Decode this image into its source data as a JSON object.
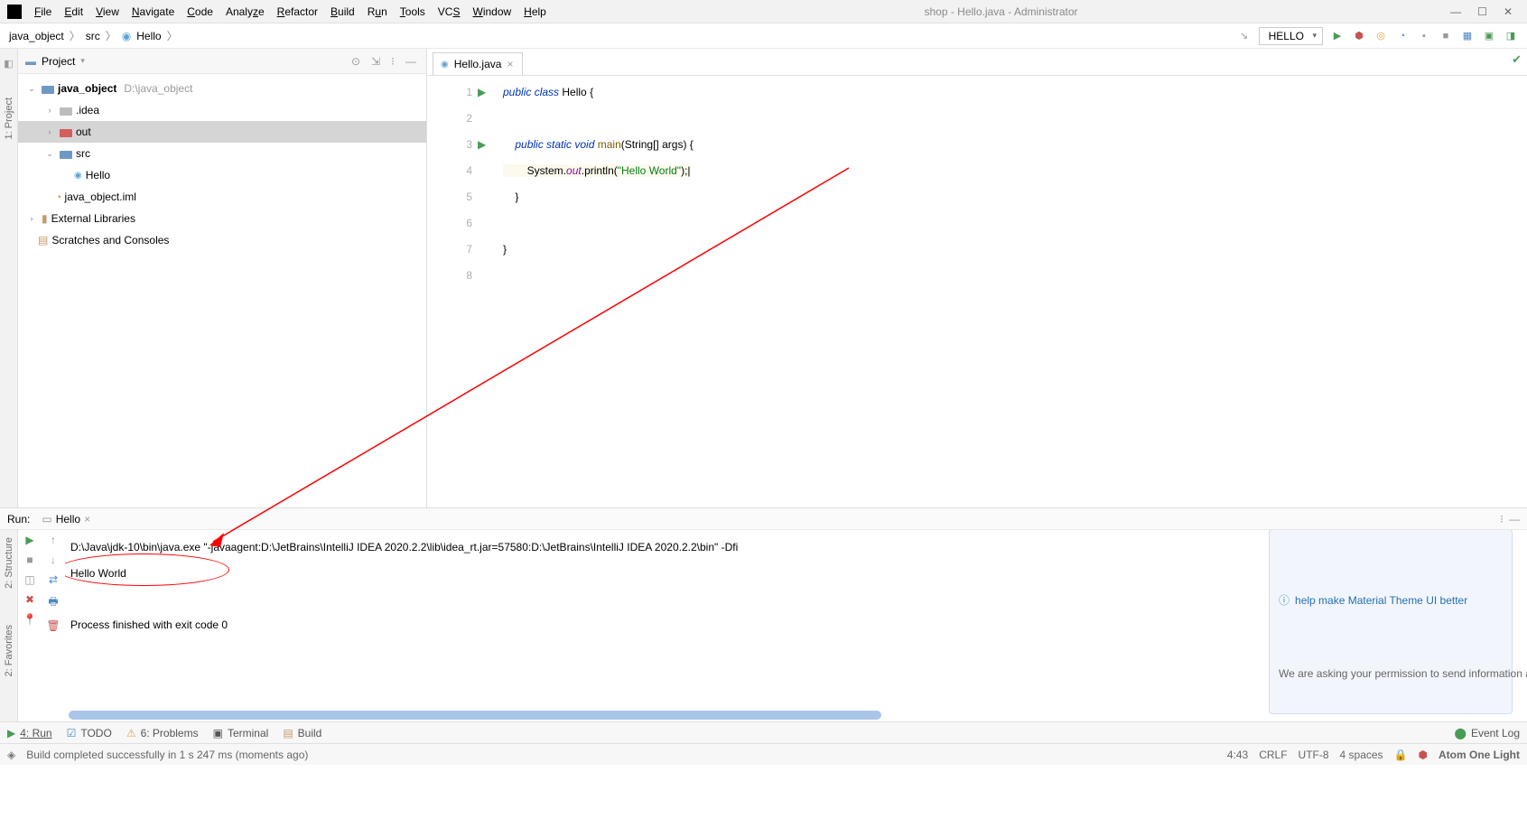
{
  "title": "shop - Hello.java - Administrator",
  "menu": [
    "File",
    "Edit",
    "View",
    "Navigate",
    "Code",
    "Analyze",
    "Refactor",
    "Build",
    "Run",
    "Tools",
    "VCS",
    "Window",
    "Help"
  ],
  "breadcrumb": [
    "java_object",
    "src",
    "Hello"
  ],
  "run_config": "HELLO",
  "project": {
    "panel_title": "Project",
    "root": "java_object",
    "root_path": "D:\\java_object",
    "children": [
      {
        "name": ".idea",
        "type": "folder-gray"
      },
      {
        "name": "out",
        "type": "folder-red",
        "selected": true
      },
      {
        "name": "src",
        "type": "folder-blue",
        "expanded": true,
        "children": [
          {
            "name": "Hello",
            "type": "class"
          }
        ]
      },
      {
        "name": "java_object.iml",
        "type": "file"
      }
    ],
    "external": "External Libraries",
    "scratches": "Scratches and Consoles"
  },
  "tab": "Hello.java",
  "lines": [
    "1",
    "2",
    "3",
    "4",
    "5",
    "6",
    "7",
    "8"
  ],
  "code": {
    "l1_kw": "public class",
    "l1_cls": "Hello",
    "l1_end": " {",
    "l3_kw": "public static void",
    "l3_mth": "main",
    "l3_sig": "(String[] args) {",
    "l4_sys": "System",
    "l4_out": "out",
    "l4_pr": "println",
    "l4_str": "\"Hello World\"",
    "l4_end": ");",
    "l5": "}",
    "l7": "}"
  },
  "run": {
    "label": "Run:",
    "tab": "Hello",
    "cmd": "D:\\Java\\jdk-10\\bin\\java.exe \"-javaagent:D:\\JetBrains\\IntelliJ IDEA 2020.2.2\\lib\\idea_rt.jar=57580:D:\\JetBrains\\IntelliJ IDEA 2020.2.2\\bin\" -Dfi",
    "out": "Hello World",
    "exit": "Process finished with exit code 0"
  },
  "notification": {
    "title": "help make Material Theme UI better",
    "body": "We are asking your permission to send information about your configuration (what..."
  },
  "bottom_tabs": [
    "4: Run",
    "TODO",
    "6: Problems",
    "Terminal",
    "Build"
  ],
  "event_log": "Event Log",
  "status": {
    "msg": "Build completed successfully in 1 s 247 ms (moments ago)",
    "pos": "4:43",
    "sep": "CRLF",
    "enc": "UTF-8",
    "indent": "4 spaces",
    "theme": "Atom One Light"
  },
  "left_tabs": [
    "1: Project"
  ],
  "left_tabs2": [
    "2: Structure",
    "2: Favorites"
  ]
}
